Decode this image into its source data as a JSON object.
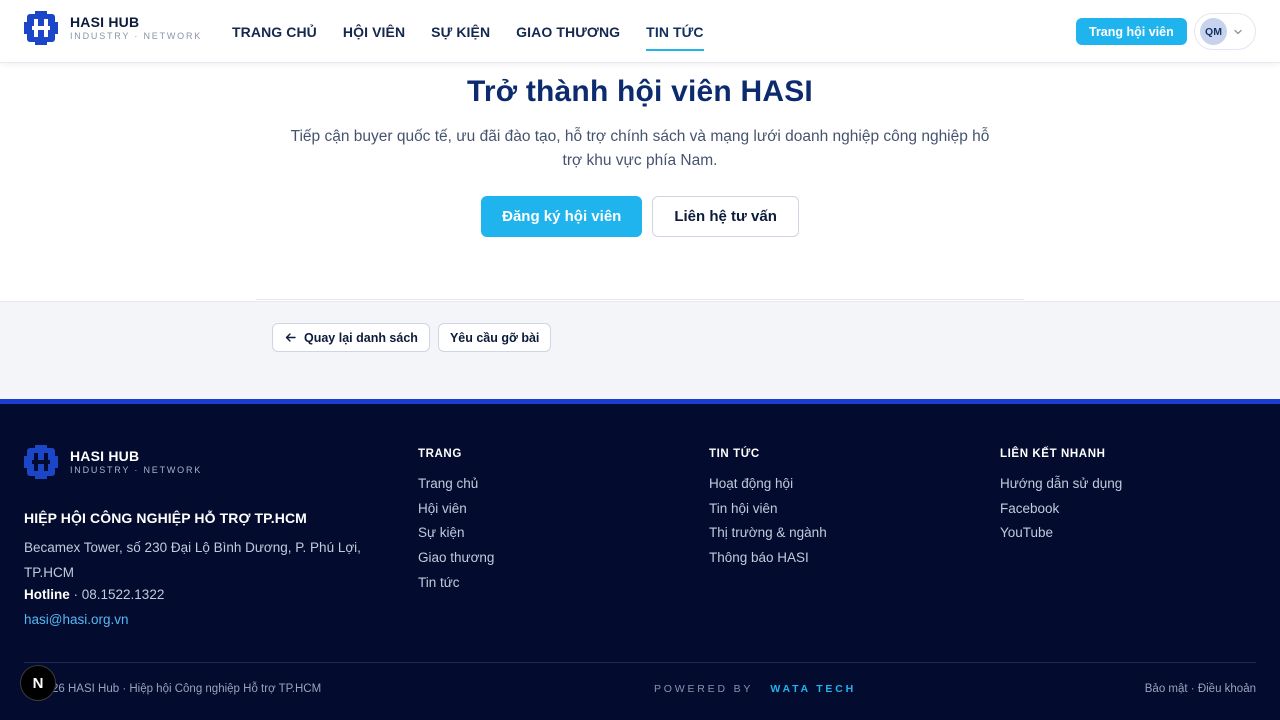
{
  "header": {
    "brand": {
      "name": "HASI HUB",
      "sub": "INDUSTRY · NETWORK"
    },
    "nav": [
      {
        "label": "TRANG CHỦ",
        "active": false
      },
      {
        "label": "HỘI VIÊN",
        "active": false
      },
      {
        "label": "SỰ KIỆN",
        "active": false
      },
      {
        "label": "GIAO THƯƠNG",
        "active": false
      },
      {
        "label": "TIN TỨC",
        "active": true
      }
    ],
    "member_button": "Trang hội viên",
    "user": {
      "initials": "QM"
    }
  },
  "cta": {
    "title": "Trở thành hội viên HASI",
    "description": "Tiếp cận buyer quốc tế, ưu đãi đào tạo, hỗ trợ chính sách và mạng lưới doanh nghiệp công nghiệp hỗ trợ khu vực phía Nam.",
    "primary_button": "Đăng ký hội viên",
    "secondary_button": "Liên hệ tư vấn"
  },
  "actions": {
    "back": "Quay lại danh sách",
    "takedown": "Yêu cầu gỡ bài"
  },
  "footer": {
    "brand": {
      "name": "HASI HUB",
      "sub": "INDUSTRY · NETWORK"
    },
    "org": "HIỆP HỘI CÔNG NGHIỆP HỖ TRỢ TP.HCM",
    "address": "Becamex Tower, số 230 Đại Lộ Bình Dương, P. Phú Lợi, TP.HCM",
    "hotline_label": "Hotline",
    "hotline": " · 08.1522.1322",
    "email": "hasi@hasi.org.vn",
    "columns": [
      {
        "title": "TRANG",
        "items": [
          "Trang chủ",
          "Hội viên",
          "Sự kiện",
          "Giao thương",
          "Tin tức"
        ]
      },
      {
        "title": "TIN TỨC",
        "items": [
          "Hoạt động hội",
          "Tin hội viên",
          "Thị trường & ngành",
          "Thông báo HASI"
        ]
      },
      {
        "title": "LIÊN KẾT NHANH",
        "items": [
          "Hướng dẫn sử dụng",
          "Facebook",
          "YouTube"
        ]
      }
    ],
    "copyright": "26 HASI Hub · Hiệp hội Công nghiệp Hỗ trợ TP.HCM",
    "powered_by": "POWERED BY",
    "powered_brand": "WATA TECH",
    "legal": "Bảo mật · Điều khoản"
  },
  "dev_badge": "N",
  "colors": {
    "accent": "#1fb4ee",
    "navy": "#0c2a6e",
    "footer_bg": "#030b2e",
    "footer_border": "#1a3fcf"
  }
}
